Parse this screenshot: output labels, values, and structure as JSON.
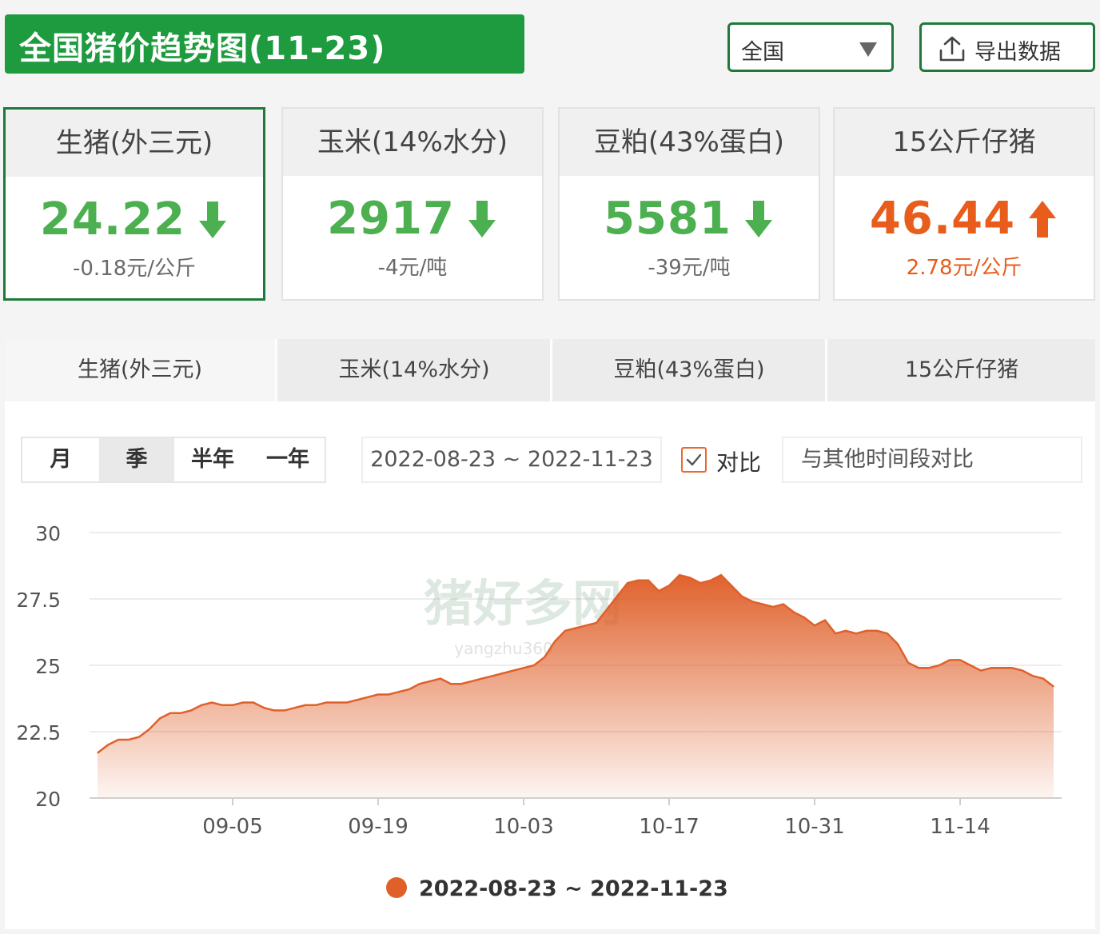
{
  "header": {
    "title": "全国猪价趋势图(11-23)"
  },
  "region_select": {
    "value": "全国"
  },
  "export_button": {
    "label": "导出数据"
  },
  "cards": [
    {
      "name": "生猪(外三元)",
      "price": "24.22",
      "change": "-0.18元/公斤",
      "direction": "down",
      "color": "#4caf50"
    },
    {
      "name": "玉米(14%水分)",
      "price": "2917",
      "change": "-4元/吨",
      "direction": "down",
      "color": "#4caf50"
    },
    {
      "name": "豆粕(43%蛋白)",
      "price": "5581",
      "change": "-39元/吨",
      "direction": "down",
      "color": "#4caf50"
    },
    {
      "name": "15公斤仔猪",
      "price": "46.44",
      "change": "2.78元/公斤",
      "direction": "up",
      "color": "#e85d1c"
    }
  ],
  "tabs": [
    "生猪(外三元)",
    "玉米(14%水分)",
    "豆粕(43%蛋白)",
    "15公斤仔猪"
  ],
  "period_options": [
    "月",
    "季",
    "半年",
    "一年"
  ],
  "selected_period": "季",
  "date_range": "2022-08-23 ~ 2022-11-23",
  "compare": {
    "label": "对比",
    "checked": true,
    "placeholder": "与其他时间段对比"
  },
  "watermark": {
    "text": "猪好多网",
    "sub": "yangzhu360"
  },
  "chart_data": {
    "type": "area",
    "color": "#e0602a",
    "ylim": [
      20,
      30
    ],
    "yticks": [
      "30",
      "27.5",
      "25",
      "22.5",
      "20"
    ],
    "xticks": [
      "09-05",
      "09-19",
      "10-03",
      "10-17",
      "10-31",
      "11-14"
    ],
    "series": [
      {
        "name": "2022-08-23 ~ 2022-11-23",
        "x": [
          "08-23",
          "08-24",
          "08-25",
          "08-26",
          "08-27",
          "08-28",
          "08-29",
          "08-30",
          "08-31",
          "09-01",
          "09-02",
          "09-03",
          "09-04",
          "09-05",
          "09-06",
          "09-07",
          "09-08",
          "09-09",
          "09-10",
          "09-11",
          "09-12",
          "09-13",
          "09-14",
          "09-15",
          "09-16",
          "09-17",
          "09-18",
          "09-19",
          "09-20",
          "09-21",
          "09-22",
          "09-23",
          "09-24",
          "09-25",
          "09-26",
          "09-27",
          "09-28",
          "09-29",
          "09-30",
          "10-01",
          "10-02",
          "10-03",
          "10-04",
          "10-05",
          "10-06",
          "10-07",
          "10-08",
          "10-09",
          "10-10",
          "10-11",
          "10-12",
          "10-13",
          "10-14",
          "10-15",
          "10-16",
          "10-17",
          "10-18",
          "10-19",
          "10-20",
          "10-21",
          "10-22",
          "10-23",
          "10-24",
          "10-25",
          "10-26",
          "10-27",
          "10-28",
          "10-29",
          "10-30",
          "10-31",
          "11-01",
          "11-02",
          "11-03",
          "11-04",
          "11-05",
          "11-06",
          "11-07",
          "11-08",
          "11-09",
          "11-10",
          "11-11",
          "11-12",
          "11-13",
          "11-14",
          "11-15",
          "11-16",
          "11-17",
          "11-18",
          "11-19",
          "11-20",
          "11-21",
          "11-22",
          "11-23"
        ],
        "values": [
          21.7,
          22.0,
          22.2,
          22.2,
          22.3,
          22.6,
          23.0,
          23.2,
          23.2,
          23.3,
          23.5,
          23.6,
          23.5,
          23.5,
          23.6,
          23.6,
          23.4,
          23.3,
          23.3,
          23.4,
          23.5,
          23.5,
          23.6,
          23.6,
          23.6,
          23.7,
          23.8,
          23.9,
          23.9,
          24.0,
          24.1,
          24.3,
          24.4,
          24.5,
          24.3,
          24.3,
          24.4,
          24.5,
          24.6,
          24.7,
          24.8,
          24.9,
          25.0,
          25.3,
          25.9,
          26.3,
          26.4,
          26.5,
          26.6,
          27.1,
          27.6,
          28.1,
          28.2,
          28.2,
          27.8,
          28.0,
          28.4,
          28.3,
          28.1,
          28.2,
          28.4,
          28.0,
          27.6,
          27.4,
          27.3,
          27.2,
          27.3,
          27.0,
          26.8,
          26.5,
          26.7,
          26.2,
          26.3,
          26.2,
          26.3,
          26.3,
          26.2,
          25.8,
          25.1,
          24.9,
          24.9,
          25.0,
          25.2,
          25.2,
          25.0,
          24.8,
          24.9,
          24.9,
          24.9,
          24.8,
          24.6,
          24.5,
          24.2
        ]
      }
    ]
  }
}
